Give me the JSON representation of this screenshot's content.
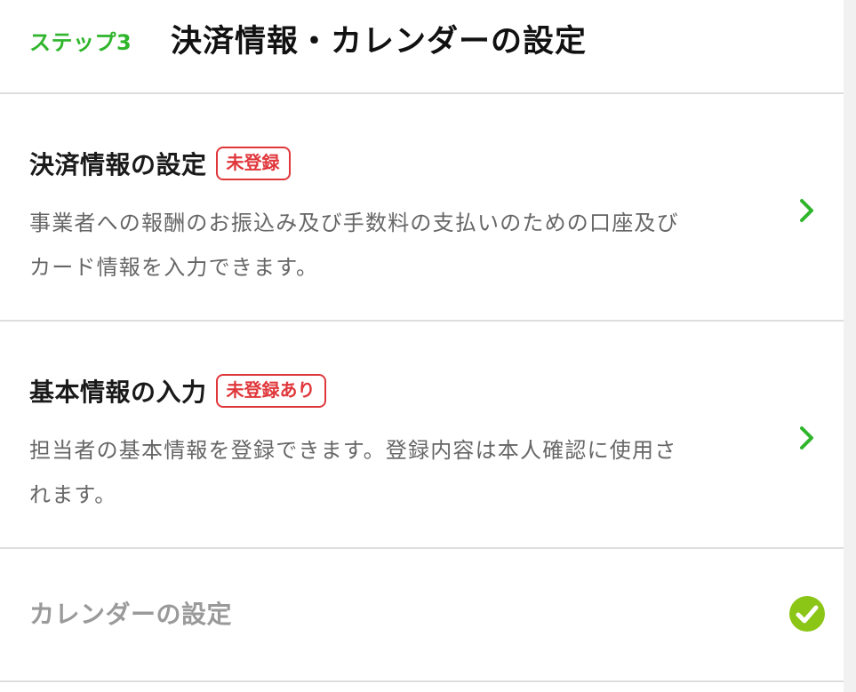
{
  "header": {
    "step_label": "ステップ3",
    "title": "決済情報・カレンダーの設定"
  },
  "sections": [
    {
      "title": "決済情報の設定",
      "badge": "未登録",
      "description_lines": [
        "事業者への報酬のお振込み及び手数料の支払いのための口座及び",
        "カード情報を入力できます。"
      ],
      "action_icon": "chevron-right-icon"
    },
    {
      "title": "基本情報の入力",
      "badge": "未登録あり",
      "description_lines": [
        "担当者の基本情報を登録できます。登録内容は本人確認に使用さ",
        "れます。"
      ],
      "action_icon": "chevron-right-icon"
    },
    {
      "title": "カレンダーの設定",
      "status_icon": "check-circle-icon"
    }
  ],
  "colors": {
    "accent_green": "#2fb52c",
    "check_green": "#8bc516",
    "badge_red": "#e0373b",
    "divider": "#dedede",
    "muted_text": "#666666",
    "disabled_title": "#9a9a9a"
  }
}
